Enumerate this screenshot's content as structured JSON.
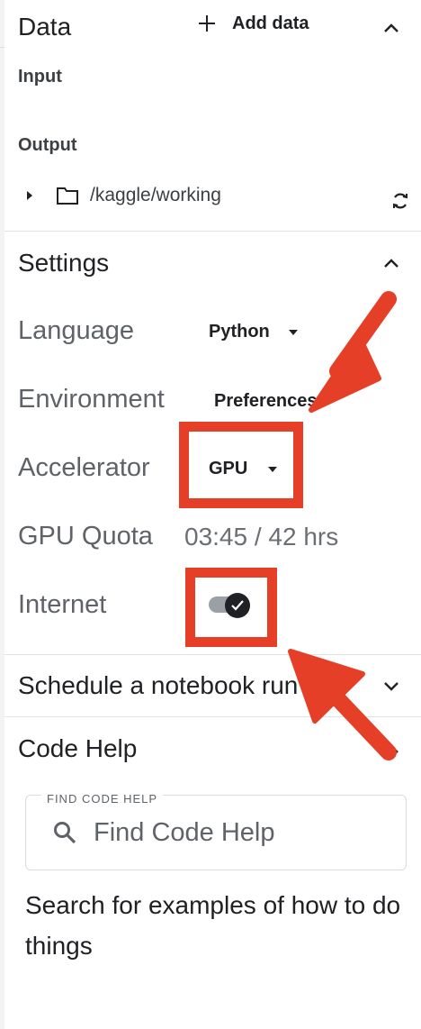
{
  "data_section": {
    "title": "Data",
    "add_data_label": "Add data",
    "input_label": "Input",
    "output_label": "Output",
    "output_path": "/kaggle/working"
  },
  "settings": {
    "title": "Settings",
    "language_label": "Language",
    "language_value": "Python",
    "environment_label": "Environment",
    "environment_value": "Preferences",
    "accelerator_label": "Accelerator",
    "accelerator_value": "GPU",
    "gpu_quota_label": "GPU Quota",
    "gpu_quota_value": "03:45 / 42 hrs",
    "internet_label": "Internet",
    "internet_on": true
  },
  "schedule": {
    "title": "Schedule a notebook run"
  },
  "code_help": {
    "title": "Code Help",
    "search_legend": "FIND CODE HELP",
    "search_placeholder": "Find Code Help",
    "description": "Search for examples of how to do things"
  },
  "colors": {
    "annotation_red": "#e53f28",
    "toggle_knob": "#202124",
    "toggle_track": "#9aa0a6"
  }
}
